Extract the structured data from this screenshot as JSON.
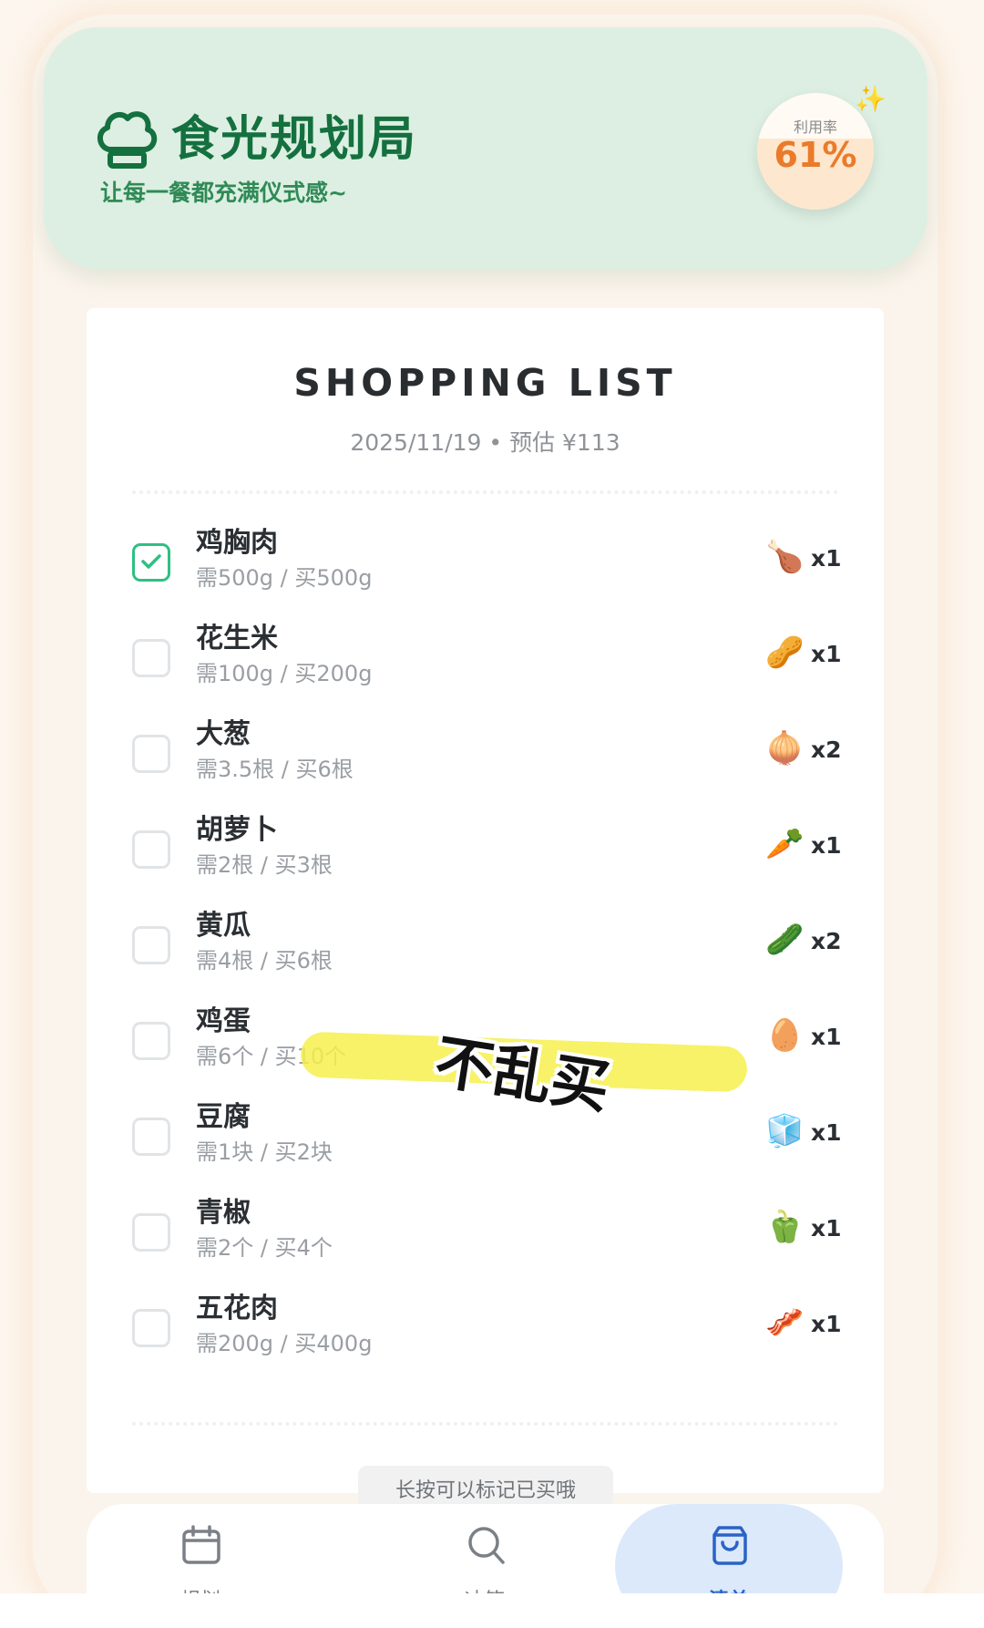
{
  "header": {
    "title": "食光规划局",
    "subtitle": "让每一餐都充满仪式感~",
    "utilization": {
      "label": "利用率",
      "value": "61%",
      "fraction": 0.61
    }
  },
  "shopping": {
    "title": "SHOPPING LIST",
    "subtitle": "2025/11/19 • 预估 ¥113",
    "items": [
      {
        "name": "鸡胸肉",
        "detail": "需500g / 买500g",
        "icon": "chicken-leg-icon",
        "glyph": "🍗",
        "qty": "x1",
        "checked": true
      },
      {
        "name": "花生米",
        "detail": "需100g / 买200g",
        "icon": "peanut-icon",
        "glyph": "🥜",
        "qty": "x1",
        "checked": false
      },
      {
        "name": "大葱",
        "detail": "需3.5根 / 买6根",
        "icon": "onion-icon",
        "glyph": "🧅",
        "qty": "x2",
        "checked": false
      },
      {
        "name": "胡萝卜",
        "detail": "需2根 / 买3根",
        "icon": "carrot-icon",
        "glyph": "🥕",
        "qty": "x1",
        "checked": false
      },
      {
        "name": "黄瓜",
        "detail": "需4根 / 买6根",
        "icon": "cucumber-icon",
        "glyph": "🥒",
        "qty": "x2",
        "checked": false
      },
      {
        "name": "鸡蛋",
        "detail": "需6个 / 买10个",
        "icon": "egg-icon",
        "glyph": "🥚",
        "qty": "x1",
        "checked": false
      },
      {
        "name": "豆腐",
        "detail": "需1块 / 买2块",
        "icon": "tofu-icon",
        "glyph": "🧊",
        "qty": "x1",
        "checked": false
      },
      {
        "name": "青椒",
        "detail": "需2个 / 买4个",
        "icon": "green-pepper-icon",
        "glyph": "🫑",
        "qty": "x1",
        "checked": false
      },
      {
        "name": "五花肉",
        "detail": "需200g / 买400g",
        "icon": "bacon-icon",
        "glyph": "🥓",
        "qty": "x1",
        "checked": false
      }
    ],
    "hint": "长按可以标记已买哦"
  },
  "sticker": {
    "text": "不乱买"
  },
  "nav": {
    "items": [
      {
        "label": "规划",
        "icon": "calendar-icon",
        "active": false
      },
      {
        "label": "冰箱",
        "icon": "search-icon",
        "active": false
      },
      {
        "label": "清单",
        "icon": "shopping-bag-icon",
        "active": true
      }
    ]
  },
  "colors": {
    "accent_green": "#14703f",
    "check_green": "#2fbf83",
    "header_bg": "#dcefe2",
    "util_orange": "#ea7b2a",
    "nav_active_bg": "#dbe9fb",
    "nav_active_text": "#2a63c6",
    "highlighter": "#f6f04d"
  }
}
